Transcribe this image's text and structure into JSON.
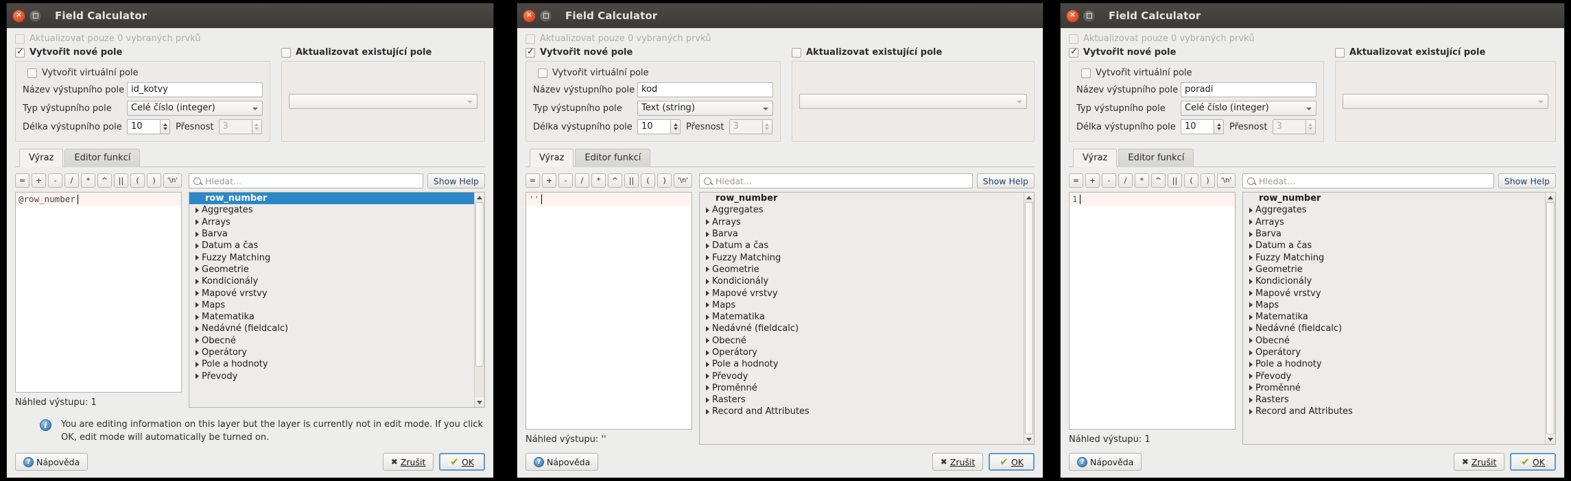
{
  "common": {
    "window_title": "Field Calculator",
    "update_selected_label": "Aktualizovat pouze 0 vybraných prvků",
    "create_new_field_label": "Vytvořit nové pole",
    "update_existing_field_label": "Aktualizovat existující pole",
    "create_virtual_field_label": "Vytvořit virtuální pole",
    "output_name_label": "Název výstupního pole",
    "output_type_label": "Typ výstupního pole",
    "output_length_label": "Délka výstupního pole",
    "precision_label": "Přesnost",
    "tab_expression": "Výraz",
    "tab_function_editor": "Editor funkcí",
    "search_placeholder": "Hledat...",
    "show_help_label": "Show Help",
    "preview_label": "Náhled výstupu:",
    "help_button": "Nápověda",
    "cancel_button": "Zrušit",
    "ok_button": "OK",
    "operators": [
      "=",
      "+",
      "-",
      "/",
      "*",
      "^",
      "||",
      "(",
      ")",
      "'\\n'"
    ],
    "tree_items": [
      "row_number",
      "Aggregates",
      "Arrays",
      "Barva",
      "Datum a čas",
      "Fuzzy Matching",
      "Geometrie",
      "Kondicionály",
      "Mapové vrstvy",
      "Maps",
      "Matematika",
      "Nedávné (fieldcalc)",
      "Obecné",
      "Operátory",
      "Pole a hodnoty",
      "Převody",
      "Proměnné",
      "Rasters",
      "Record and Attributes"
    ],
    "accent_selection_color": "#2b87c8",
    "titlebar_color": "#3c3936",
    "close_button_color": "#d9482a"
  },
  "dialogs": [
    {
      "id": "dialog-1",
      "output_name_value": "id_kotvy",
      "output_type_value": "Celé číslo (integer)",
      "output_length_value": "10",
      "precision_value": "3",
      "expression_text": "@row_number",
      "expression_token_class": "tok-var",
      "preview_value": "1",
      "tree_selected_index": 0,
      "visible_tree_count": 16,
      "info_message": "You are editing information on this layer but the layer is currently not in edit mode. If you click OK, edit mode will automatically be turned on.",
      "has_info": true
    },
    {
      "id": "dialog-2",
      "output_name_value": "kod",
      "output_type_value": "Text (string)",
      "output_length_value": "10",
      "precision_value": "3",
      "expression_text": "''",
      "expression_token_class": "tok-str",
      "preview_value": "''",
      "tree_selected_index": -1,
      "visible_tree_count": 19,
      "info_message": "",
      "has_info": false
    },
    {
      "id": "dialog-3",
      "output_name_value": "poradi",
      "output_type_value": "Celé číslo (integer)",
      "output_length_value": "10",
      "precision_value": "3",
      "expression_text": "1",
      "expression_token_class": "tok-num",
      "preview_value": "1",
      "tree_selected_index": -1,
      "visible_tree_count": 19,
      "info_message": "",
      "has_info": false
    }
  ]
}
